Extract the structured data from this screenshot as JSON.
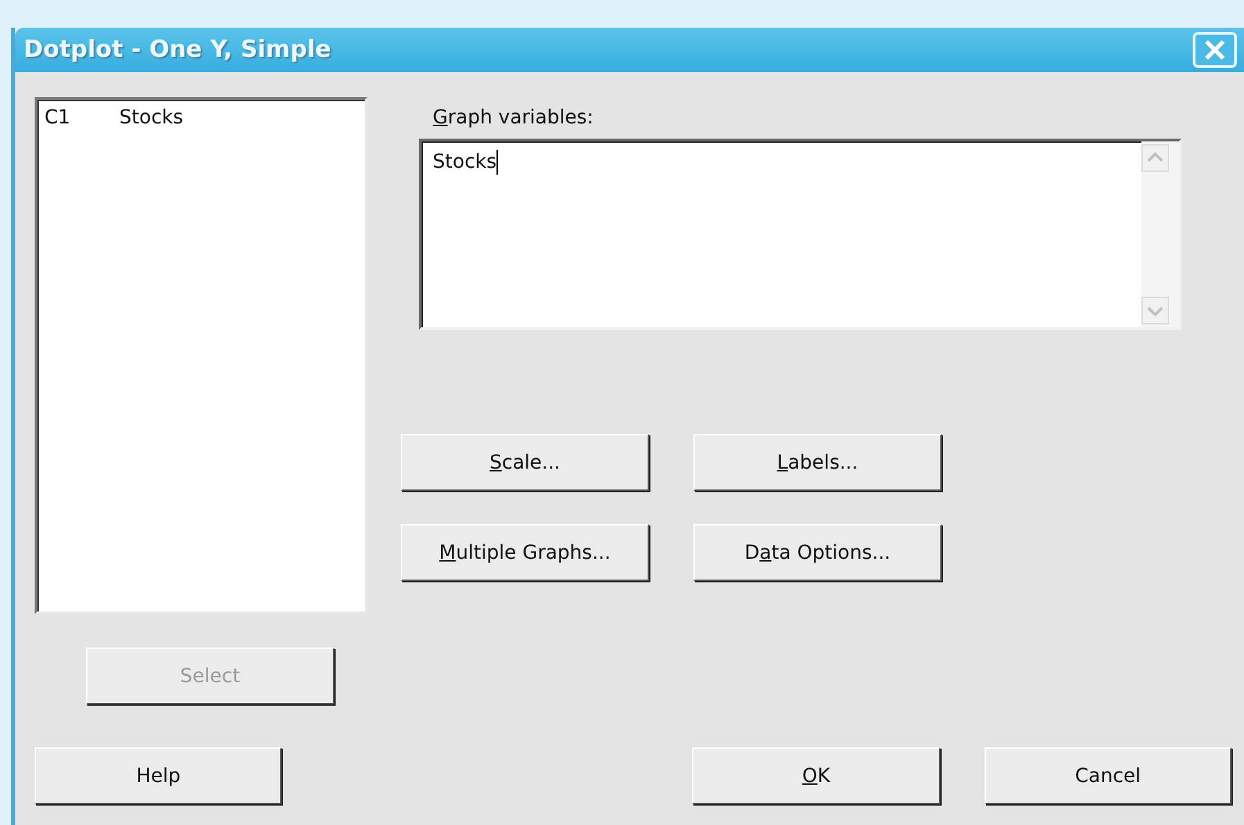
{
  "window": {
    "title": "Dotplot - One Y, Simple"
  },
  "column_list": {
    "items": [
      {
        "column": "C1",
        "name": "Stocks",
        "selected": false
      }
    ]
  },
  "graph_variables": {
    "label": [
      {
        "text": "G",
        "underline": true
      },
      {
        "text": "raph variables:",
        "underline": false
      }
    ],
    "value": "Stocks"
  },
  "option_buttons": [
    {
      "label": [
        {
          "text": "S",
          "underline": true
        },
        {
          "text": "cale...",
          "underline": false
        }
      ]
    },
    {
      "label": [
        {
          "text": "L",
          "underline": true
        },
        {
          "text": "abels...",
          "underline": false
        }
      ]
    },
    {
      "label": [
        {
          "text": "M",
          "underline": true
        },
        {
          "text": "ultiple Graphs...",
          "underline": false
        }
      ]
    },
    {
      "label": [
        {
          "text": "D",
          "underline": false
        },
        {
          "text": "a",
          "underline": true
        },
        {
          "text": "ta Options...",
          "underline": false
        }
      ]
    }
  ],
  "select_button": {
    "label": "Select",
    "disabled": true
  },
  "buttons": [
    {
      "label": [
        {
          "text": "Help",
          "underline": false
        }
      ]
    },
    {
      "label": [
        {
          "text": "O",
          "underline": true
        },
        {
          "text": "K",
          "underline": false
        }
      ]
    },
    {
      "label": [
        {
          "text": "Cancel",
          "underline": false
        }
      ]
    }
  ]
}
